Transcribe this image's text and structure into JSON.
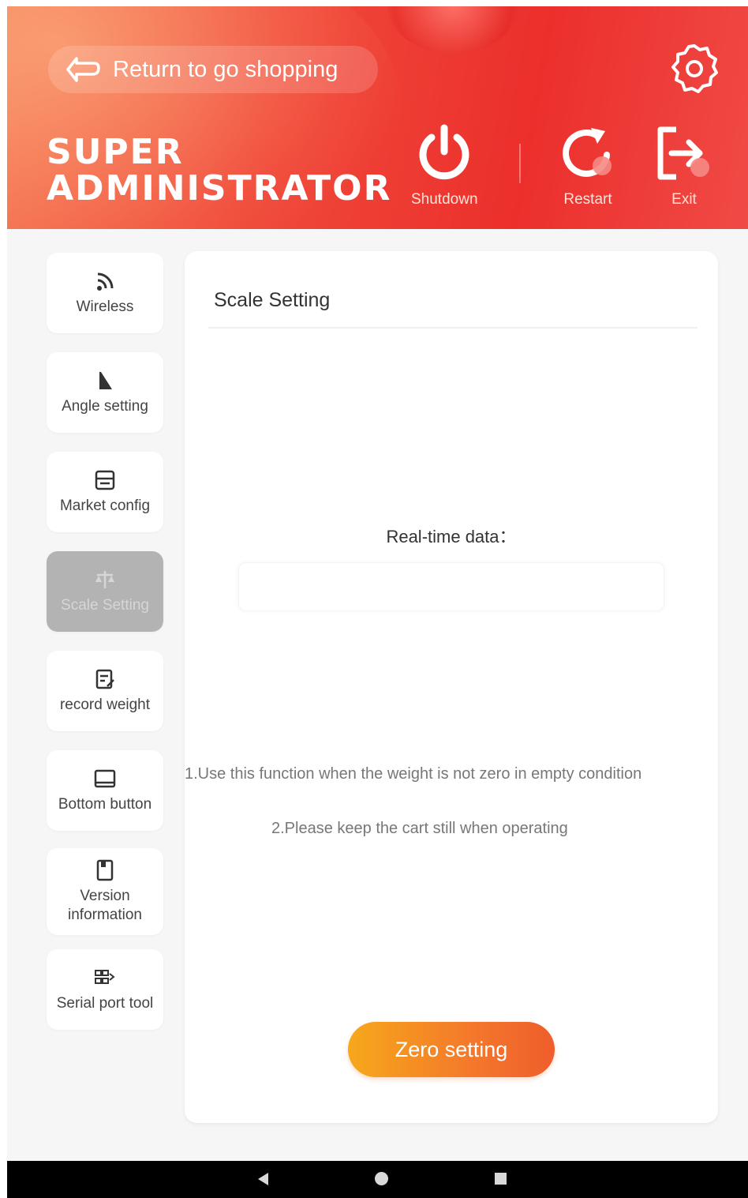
{
  "header": {
    "return_label": "Return to go shopping",
    "title_line1": "SUPER",
    "title_line2": "ADMINISTRATOR",
    "shutdown_label": "Shutdown",
    "restart_label": "Restart",
    "exit_label": "Exit",
    "icons": {
      "return": "return-arrow-icon",
      "settings": "gear-icon",
      "shutdown": "power-icon",
      "restart": "restart-icon",
      "exit": "exit-icon"
    }
  },
  "sidebar": {
    "items": [
      {
        "label": "Wireless",
        "icon": "wifi-icon"
      },
      {
        "label": "Angle setting",
        "icon": "angle-icon"
      },
      {
        "label": "Market config",
        "icon": "market-icon"
      },
      {
        "label": "Scale Setting",
        "icon": "scale-icon",
        "active": true
      },
      {
        "label": "record weight",
        "icon": "record-icon"
      },
      {
        "label": "Bottom button",
        "icon": "screen-icon"
      },
      {
        "label": "Version information",
        "icon": "version-icon"
      },
      {
        "label": "Serial port tool",
        "icon": "serial-port-icon"
      }
    ]
  },
  "panel": {
    "title": "Scale Setting",
    "realtime_label": "Real-time data：",
    "realtime_value": "",
    "note1": "1.Use this function when the weight is not zero in empty condition",
    "note2": "2.Please keep the cart still when operating",
    "zero_button": "Zero setting"
  },
  "colors": {
    "header_red": "#ec2f2c",
    "button_orange": "#f4782b",
    "active_gray": "#b3b3b3"
  }
}
